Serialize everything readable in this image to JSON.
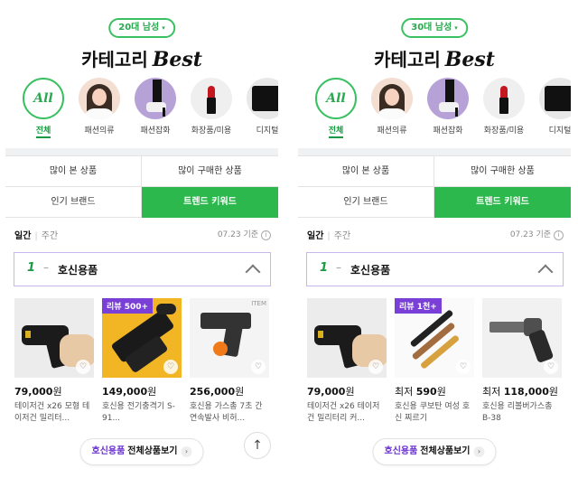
{
  "colors": {
    "accent_green": "#2db84d",
    "badge_purple": "#7a3fd6",
    "keyword_border": "#c7b7ec"
  },
  "panels": [
    {
      "segment": {
        "label": "20대 남성",
        "caret": "▾"
      },
      "title": {
        "text": "카테고리",
        "accent": "Best"
      },
      "categories": [
        {
          "label": "전체",
          "circle": "All",
          "icon": "all-icon"
        },
        {
          "label": "패션의류",
          "icon": "fashion-clothing-icon"
        },
        {
          "label": "패션잡화",
          "icon": "fashion-accessory-icon"
        },
        {
          "label": "화장품/미용",
          "icon": "cosmetics-icon"
        },
        {
          "label": "디지털",
          "icon": "digital-icon"
        }
      ],
      "tiles": [
        {
          "label": "많이 본 상품",
          "active": false
        },
        {
          "label": "많이 구매한 상품",
          "active": false
        },
        {
          "label": "인기 브랜드",
          "active": false
        },
        {
          "label": "트렌드 키워드",
          "active": true
        }
      ],
      "period": {
        "active": "일간",
        "inactive": "주간"
      },
      "reference": {
        "text": "07.23 기준",
        "icon": "info-icon"
      },
      "keyword": {
        "rank": "1",
        "dash": "–",
        "text": "호신용품",
        "icon": "chevron-up-icon"
      },
      "products": [
        {
          "badge": "",
          "price_prefix": "",
          "price": "79,000",
          "unit": "원",
          "name": "테이저건 x26 모형 테이저건 밀리터...",
          "heart": "♡"
        },
        {
          "badge": "리뷰 500+",
          "price_prefix": "",
          "price": "149,000",
          "unit": "원",
          "name": "호신용 전기충격기 S-91...",
          "heart": "♡"
        },
        {
          "badge": "",
          "price_prefix": "",
          "price": "256,000",
          "unit": "원",
          "name": "호신용 가스총 7초 간연속발사 비허...",
          "heart": "♡",
          "tag": "ITEM"
        }
      ],
      "cta": {
        "highlight": "호신용품",
        "rest": "전체상품보기",
        "arrow": "›"
      },
      "top_button": {
        "icon": "arrow-up-icon",
        "glyph": "↑"
      }
    },
    {
      "segment": {
        "label": "30대 남성",
        "caret": "▾"
      },
      "title": {
        "text": "카테고리",
        "accent": "Best"
      },
      "categories": [
        {
          "label": "전체",
          "circle": "All",
          "icon": "all-icon"
        },
        {
          "label": "패션의류",
          "icon": "fashion-clothing-icon"
        },
        {
          "label": "패션잡화",
          "icon": "fashion-accessory-icon"
        },
        {
          "label": "화장품/미용",
          "icon": "cosmetics-icon"
        },
        {
          "label": "디지털",
          "icon": "digital-icon"
        }
      ],
      "tiles": [
        {
          "label": "많이 본 상품",
          "active": false
        },
        {
          "label": "많이 구매한 상품",
          "active": false
        },
        {
          "label": "인기 브랜드",
          "active": false
        },
        {
          "label": "트렌드 키워드",
          "active": true
        }
      ],
      "period": {
        "active": "일간",
        "inactive": "주간"
      },
      "reference": {
        "text": "07.23 기준",
        "icon": "info-icon"
      },
      "keyword": {
        "rank": "1",
        "dash": "–",
        "text": "호신용품",
        "icon": "chevron-up-icon"
      },
      "products": [
        {
          "badge": "",
          "price_prefix": "",
          "price": "79,000",
          "unit": "원",
          "name": "테이저건 x26 테이저건 밀리터리 커...",
          "heart": "♡"
        },
        {
          "badge": "리뷰 1천+",
          "price_prefix": "최저 ",
          "price": "590",
          "unit": "원",
          "name": "호신용 쿠보탄 여성 호신 찌르기",
          "heart": "♡"
        },
        {
          "badge": "",
          "price_prefix": "최저 ",
          "price": "118,000",
          "unit": "원",
          "name": "호신용 리볼버가스총 B-38",
          "heart": "♡"
        }
      ],
      "cta": {
        "highlight": "호신용품",
        "rest": "전체상품보기",
        "arrow": "›"
      }
    }
  ]
}
